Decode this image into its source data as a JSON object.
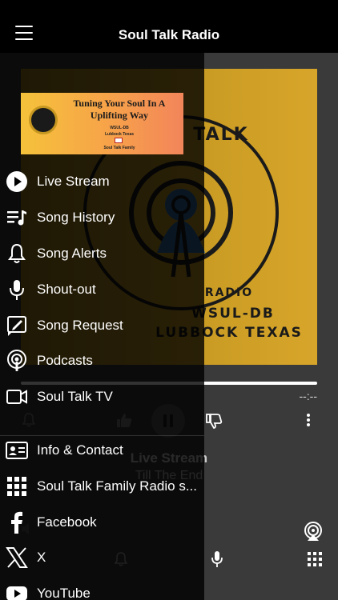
{
  "header": {
    "title": "Soul Talk Radio"
  },
  "player": {
    "artwork": {
      "arc_text": "TALK",
      "line1": "RADIO",
      "line2": "WSUL-DB",
      "line3": "LUBBOCK TEXAS"
    },
    "time_remaining": "--:--",
    "now_playing": {
      "title": "Live Stream",
      "artist": "Till The End"
    }
  },
  "drawer": {
    "banner": {
      "headline": "Tuning Your Soul In A Uplifting Way",
      "station": "WSUL-DB",
      "city": "Lubbock Texas",
      "family": "Soul Talk Family"
    },
    "items": [
      {
        "label": "Live Stream",
        "icon": "play-circle-icon"
      },
      {
        "label": "Song History",
        "icon": "playlist-icon"
      },
      {
        "label": "Song Alerts",
        "icon": "bell-icon"
      },
      {
        "label": "Shout-out",
        "icon": "microphone-icon"
      },
      {
        "label": "Song Request",
        "icon": "request-icon"
      },
      {
        "label": "Podcasts",
        "icon": "podcast-icon"
      },
      {
        "label": "Soul Talk TV",
        "icon": "video-icon"
      },
      {
        "label": "Info & Contact",
        "icon": "contact-card-icon"
      },
      {
        "label": "Soul Talk Family Radio s...",
        "icon": "grid-icon"
      },
      {
        "label": "Facebook",
        "icon": "facebook-icon"
      },
      {
        "label": "X",
        "icon": "x-logo-icon"
      },
      {
        "label": "YouTube",
        "icon": "youtube-icon"
      }
    ]
  },
  "colors": {
    "accent": "#d4a02a",
    "background": "#000000",
    "player_bg": "#3a3a3a"
  }
}
